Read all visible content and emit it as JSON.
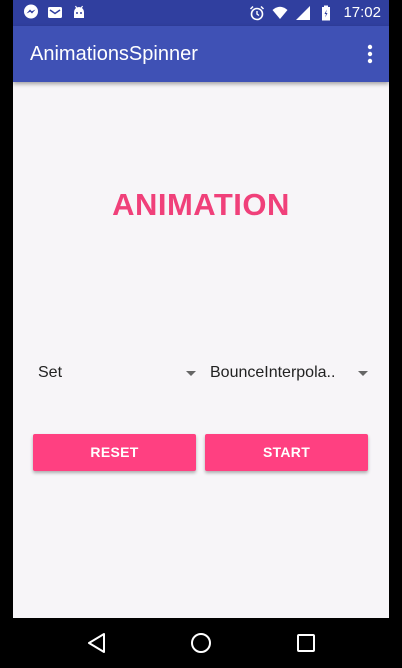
{
  "status_bar": {
    "time": "17:02",
    "left_icons": [
      "messenger-icon",
      "mail-icon",
      "android-icon"
    ],
    "right_icons": [
      "alarm-icon",
      "wifi-icon",
      "signal-icon",
      "battery-icon"
    ]
  },
  "app_bar": {
    "title": "AnimationsSpinner",
    "menu_icon": "overflow-menu-icon"
  },
  "main": {
    "heading": "ANIMATION",
    "spinner_animation": {
      "selected": "Set"
    },
    "spinner_interpolator": {
      "selected": "BounceInterpola.."
    },
    "reset_label": "RESET",
    "start_label": "START"
  },
  "nav_bar": {
    "icons": [
      "back-icon",
      "home-icon",
      "recents-icon"
    ]
  },
  "colors": {
    "status_bar": "#303f9f",
    "app_bar": "#3f51b5",
    "accent": "#ff4081",
    "heading": "#f0407a",
    "background": "#f7f5f8"
  }
}
